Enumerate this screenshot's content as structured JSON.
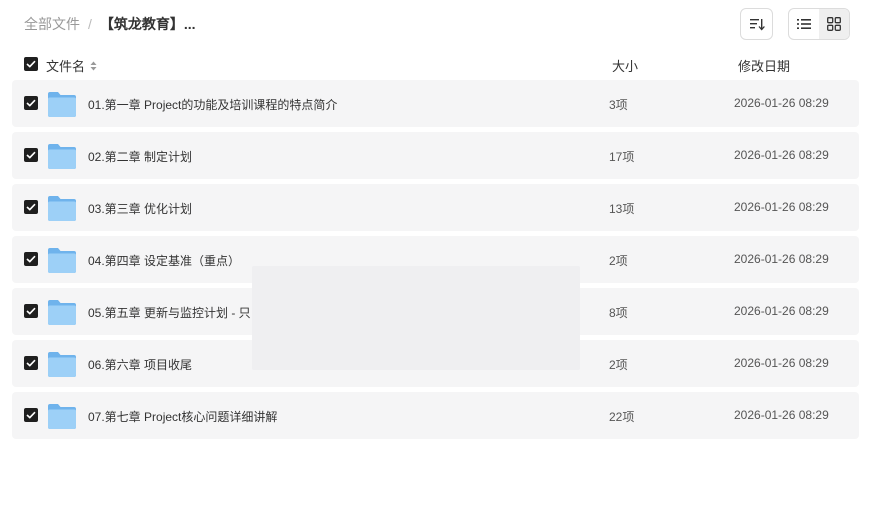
{
  "breadcrumb": {
    "root": "全部文件",
    "separator": "/",
    "current": "【筑龙教育】..."
  },
  "toolbar": {
    "sort_icon": "sort-lines-icon",
    "view_list_icon": "list-view-icon",
    "view_grid_icon": "grid-view-icon",
    "active_view": "list"
  },
  "table": {
    "headers": {
      "name": "文件名",
      "size": "大小",
      "date": "修改日期"
    },
    "rows": [
      {
        "name": "01.第一章 Project的功能及培训课程的特点简介",
        "size": "3项",
        "date": "2026-01-26 08:29",
        "checked": true
      },
      {
        "name": "02.第二章 制定计划",
        "size": "17项",
        "date": "2026-01-26 08:29",
        "checked": true
      },
      {
        "name": "03.第三章 优化计划",
        "size": "13项",
        "date": "2026-01-26 08:29",
        "checked": true
      },
      {
        "name": "04.第四章 设定基准（重点）",
        "size": "2项",
        "date": "2026-01-26 08:29",
        "checked": true
      },
      {
        "name": "05.第五章 更新与监控计划 - 只",
        "size": "8项",
        "date": "2026-01-26 08:29",
        "checked": true
      },
      {
        "name": "06.第六章 项目收尾",
        "size": "2项",
        "date": "2026-01-26 08:29",
        "checked": true
      },
      {
        "name": "07.第七章 Project核心问题详细讲解",
        "size": "22项",
        "date": "2026-01-26 08:29",
        "checked": true
      }
    ]
  },
  "colors": {
    "row_bg": "#f5f5f6",
    "checkbox": "#1f1f1f",
    "folder_light": "#9dd0f7",
    "folder_dark": "#6fb3ec"
  }
}
